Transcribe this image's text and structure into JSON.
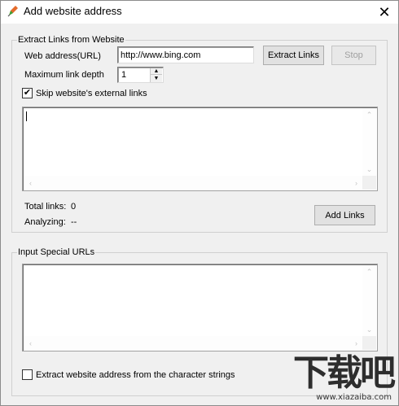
{
  "window": {
    "title": "Add website address",
    "close_glyph": "✕"
  },
  "extract_group": {
    "label": "Extract Links from Website",
    "web_address_label": "Web address(URL)",
    "web_address_value": "http://www.bing.com",
    "max_depth_label": "Maximum link depth",
    "max_depth_value": "1",
    "extract_button": "Extract Links",
    "stop_button": "Stop",
    "skip_external_label": "Skip website's external links",
    "skip_external_checked": true,
    "check_glyph": "✔",
    "total_links_label": "Total links:",
    "total_links_value": "0",
    "analyzing_label": "Analyzing:",
    "analyzing_value": "--",
    "add_links_button": "Add Links"
  },
  "special_group": {
    "label": "Input Special URLs",
    "extract_strings_label": "Extract website address from the character strings",
    "extract_strings_checked": false
  },
  "watermark": {
    "big": "下载吧",
    "url": "www.xiazaiba.com"
  },
  "icons": {
    "app": "pencil-icon",
    "close": "close-icon"
  }
}
